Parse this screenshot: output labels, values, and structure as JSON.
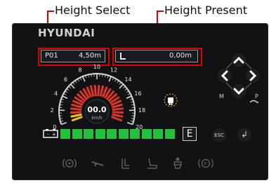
{
  "callouts": {
    "height_select": "Height Select",
    "height_present": "Height Present"
  },
  "brand": "HYUNDAI",
  "height_select": {
    "position": "P01",
    "value": "4,50m"
  },
  "height_present": {
    "value": "0,00m"
  },
  "speedometer": {
    "ticks": [
      "0",
      "2",
      "4",
      "6",
      "8",
      "10",
      "12",
      "14",
      "16",
      "18",
      "20"
    ],
    "speed": "00.0",
    "unit": "km/h",
    "max": 20,
    "current": 0
  },
  "fuel": {
    "segments_lit": 10,
    "segments_total": 10,
    "gear_label": "E"
  },
  "nav": {
    "m_label": "M",
    "p_label": "P",
    "esc_label": "ESC"
  },
  "bottom_icons": [
    "parking-brake",
    "boom",
    "mast-tilt",
    "seat",
    "operator",
    "parking"
  ],
  "colors": {
    "accent_red": "#e00000",
    "fuel_green": "#22c33a",
    "gauge_red": "#e0352a",
    "gauge_yellow": "#f2c21b",
    "lamp_orange": "#f0a020"
  }
}
